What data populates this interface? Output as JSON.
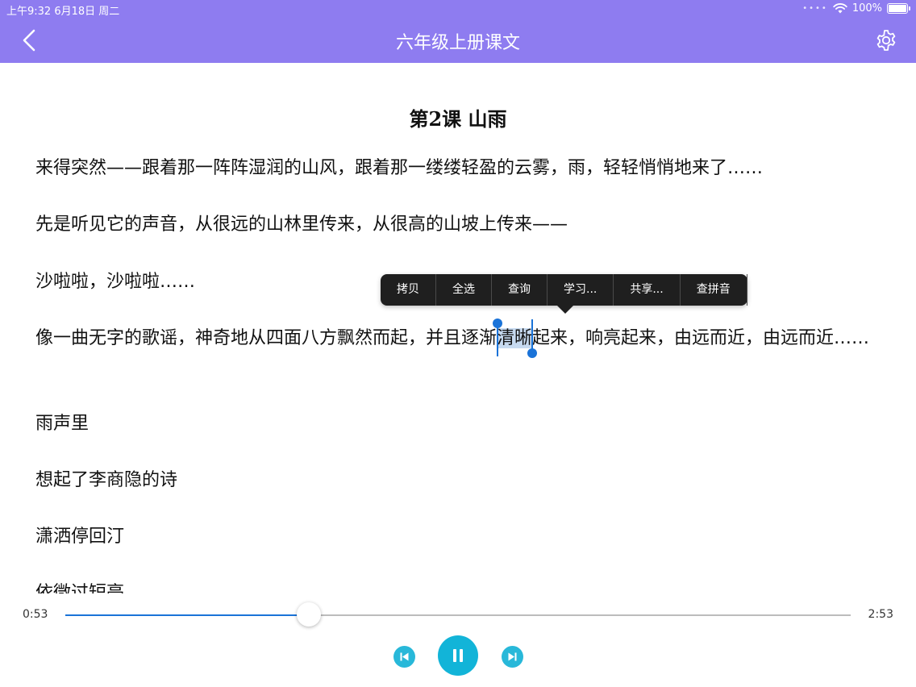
{
  "status_bar": {
    "time_date": "上午9:32   6月18日 周二",
    "signal": "••••",
    "battery_percent": "100%"
  },
  "navbar": {
    "title": "六年级上册课文",
    "back_icon": "chevron-left-icon",
    "settings_icon": "gear-icon",
    "color": "#8e7cf0"
  },
  "lesson": {
    "title": "第2课 山雨",
    "paragraphs": [
      "来得突然——跟着那一阵阵湿润的山风，跟着那一缕缕轻盈的云雾，雨，轻轻悄悄地来了……",
      "先是听见它的声音，从很远的山林里传来，从很高的山坡上传来——",
      "沙啦啦，沙啦啦……",
      "雨声里",
      "想起了李商隐的诗",
      "潇洒停回汀",
      "依微过短亭"
    ],
    "p4_before": "像一曲无字的歌谣，神奇地从四面八方飘然而起，并且逐渐",
    "p4_selected": "清晰",
    "p4_after": "起来，响亮起来，由远而近，由远而近……",
    "selection_color": "#c7daf0"
  },
  "context_menu": {
    "items": [
      "拷贝",
      "全选",
      "查询",
      "学习...",
      "共享...",
      "查拼音"
    ]
  },
  "player": {
    "current_time": "0:53",
    "total_time": "2:53",
    "progress": 0.31,
    "accent": "#12b4d8"
  }
}
